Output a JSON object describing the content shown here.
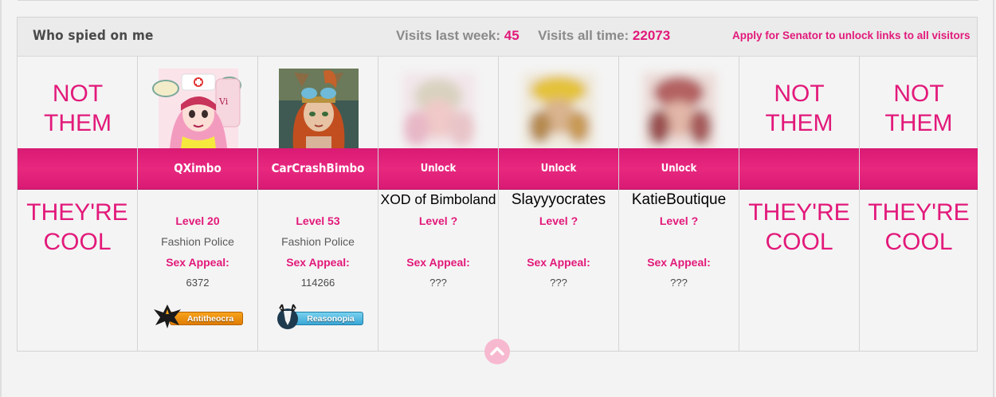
{
  "header": {
    "title": "Who spied on me",
    "visits_week_label": "Visits last week:",
    "visits_week_value": "45",
    "visits_all_label": "Visits all time:",
    "visits_all_value": "22073",
    "apply_link": "Apply for Senator to unlock links to all visitors"
  },
  "colors": {
    "accent": "#e2197a",
    "band": "#e02278",
    "header_bg": "#ebebeb",
    "scroll_button": "#f7b9cf"
  },
  "columns": [
    {
      "type": "placeholder",
      "top_text": "NOT THEM",
      "bottom_text": "THEY'RE COOL"
    },
    {
      "type": "visitor",
      "name": "QXimbo",
      "level": "Level 20",
      "rank": "Fashion Police",
      "sex_appeal_label": "Sex Appeal:",
      "sex_appeal": "6372",
      "badge": "Antitheocra",
      "badge_icon": "eagle-emblem-icon"
    },
    {
      "type": "visitor",
      "name": "CarCrashBimbo",
      "level": "Level 53",
      "rank": "Fashion Police",
      "sex_appeal_label": "Sex Appeal:",
      "sex_appeal": "114266",
      "badge": "Reasonopia",
      "badge_icon": "stag-emblem-icon"
    },
    {
      "type": "locked",
      "unlock_label": "Unlock",
      "name": "XOD of Bimboland",
      "level": "Level ?",
      "sex_appeal_label": "Sex Appeal:",
      "sex_appeal": "???"
    },
    {
      "type": "locked",
      "unlock_label": "Unlock",
      "name": "Slayyyocrates",
      "level": "Level ?",
      "sex_appeal_label": "Sex Appeal:",
      "sex_appeal": "???"
    },
    {
      "type": "locked",
      "unlock_label": "Unlock",
      "name": "KatieBoutique",
      "level": "Level ?",
      "sex_appeal_label": "Sex Appeal:",
      "sex_appeal": "???"
    },
    {
      "type": "placeholder",
      "top_text": "NOT THEM",
      "bottom_text": "THEY'RE COOL"
    },
    {
      "type": "placeholder",
      "top_text": "NOT THEM",
      "bottom_text": "THEY'RE COOL"
    }
  ],
  "scroll_up_icon": "chevron-up-icon"
}
